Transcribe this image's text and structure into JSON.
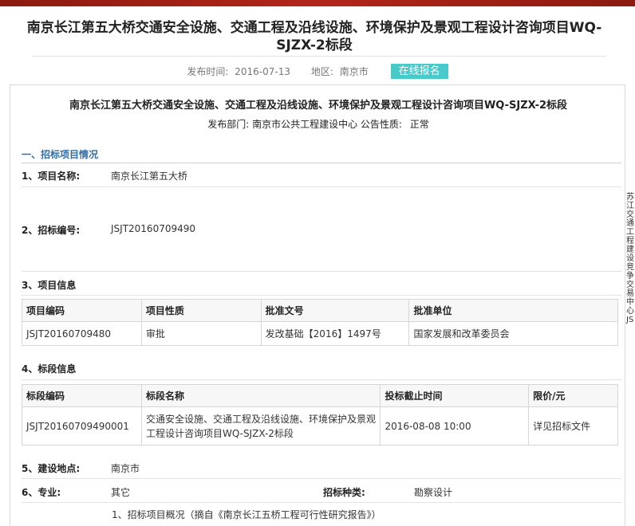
{
  "header": {
    "title": "南京长江第五大桥交通安全设施、交通工程及沿线设施、环境保护及景观工程设计咨询项目WQ-SJZX-2标段",
    "publish_label": "发布时间:",
    "publish_date": "2016-07-13",
    "region_label": "地区:",
    "region_value": "南京市",
    "signup_button": "在线报名"
  },
  "notice": {
    "title": "南京长江第五大桥交通安全设施、交通工程及沿线设施、环境保护及景观工程设计咨询项目WQ-SJZX-2标段",
    "dept_label": "发布部门:",
    "dept_value": "南京市公共工程建设中心",
    "nature_label": "公告性质:",
    "nature_value": "正常"
  },
  "section1": {
    "heading": "一、招标项目情况",
    "project_name_label": "1、项目名称:",
    "project_name_value": "南京长江第五大桥",
    "tender_no_label": "2、招标编号:",
    "tender_no_value": "JSJT20160709490",
    "project_info_label": "3、项目信息",
    "project_table": {
      "headers": [
        "项目编码",
        "项目性质",
        "批准文号",
        "批准单位"
      ],
      "rows": [
        [
          "JSJT20160709480",
          "审批",
          "发改基础【2016】1497号",
          "国家发展和改革委员会"
        ]
      ]
    },
    "section_info_label": "4、标段信息",
    "section_table": {
      "headers": [
        "标段编码",
        "标段名称",
        "投标截止时间",
        "限价/元"
      ],
      "rows": [
        [
          "JSJT20160709490001",
          "交通安全设施、交通工程及沿线设施、环境保护及景观工程设计咨询项目WQ-SJZX-2标段",
          "2016-08-08 10:00",
          "详见招标文件"
        ]
      ]
    },
    "site_label": "5、建设地点:",
    "site_value": "南京市",
    "specialty_label": "6、专业:",
    "specialty_value": "其它",
    "tender_type_label": "招标种类:",
    "tender_type_value": "勘察设计",
    "overview_text": "1、招标项目概况（摘自《南京长江五桥工程可行性研究报告》）"
  },
  "side_note": "苏江交通工程建设竞争交易中心JS"
}
